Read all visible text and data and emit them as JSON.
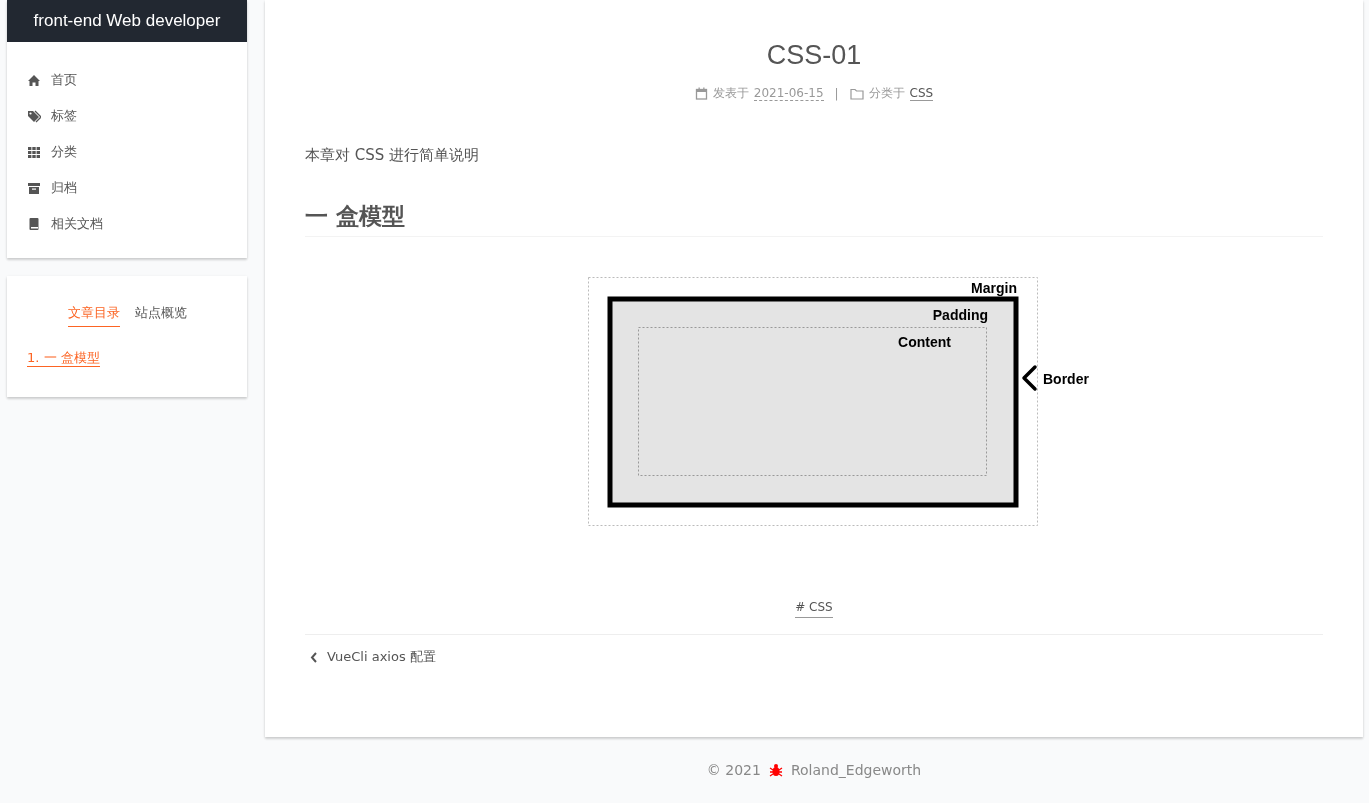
{
  "site_title": "front-end Web developer",
  "menu": [
    {
      "label": "首页"
    },
    {
      "label": "标签"
    },
    {
      "label": "分类"
    },
    {
      "label": "归档"
    },
    {
      "label": "相关文档"
    }
  ],
  "sidebar_tabs": [
    {
      "label": "文章目录",
      "selected": true
    },
    {
      "label": "站点概览",
      "selected": false
    }
  ],
  "toc": [
    {
      "label": "1. 一 盒模型",
      "active": true
    }
  ],
  "post": {
    "title": "CSS-01",
    "meta": {
      "posted_label": "发表于",
      "date": "2021-06-15",
      "separator": "|",
      "category_label": "分类于",
      "category": "CSS"
    },
    "intro": "本章对 CSS 进行简单说明",
    "heading": "一 盒模型",
    "diagram": {
      "margin": "Margin",
      "padding": "Padding",
      "content": "Content",
      "border": "Border"
    },
    "tags": [
      "# CSS"
    ],
    "prev_post": "VueCli axios 配置"
  },
  "footer": {
    "copyright": "© 2021",
    "author": "Roland_Edgeworth"
  }
}
